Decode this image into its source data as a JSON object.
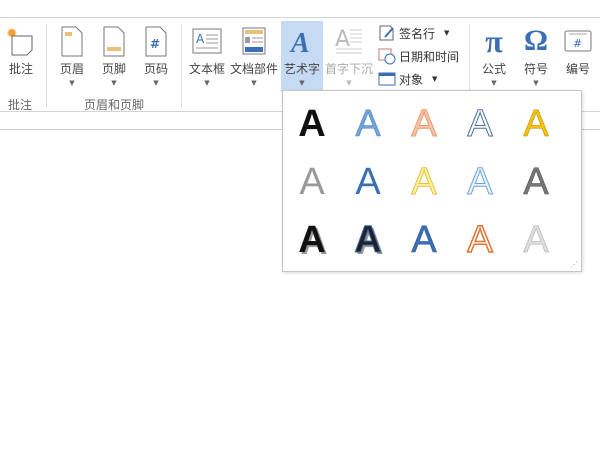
{
  "ribbon": {
    "comment": {
      "label": "批注",
      "group": "批注"
    },
    "header": {
      "label": "页眉"
    },
    "footer": {
      "label": "页脚"
    },
    "page_number": {
      "label": "页码"
    },
    "hf_group": "页眉和页脚",
    "textbox": {
      "label": "文本框"
    },
    "quick_parts": {
      "label": "文档部件"
    },
    "wordart": {
      "label": "艺术字"
    },
    "dropcap": {
      "label": "首字下沉"
    },
    "signature": {
      "label": "签名行"
    },
    "datetime": {
      "label": "日期和时间"
    },
    "object": {
      "label": "对象"
    },
    "equation": {
      "label": "公式"
    },
    "symbol": {
      "label": "符号"
    },
    "numbering": {
      "label": "编号"
    }
  },
  "gallery": {
    "glyph": "A",
    "accent": "#c5dbf3"
  }
}
